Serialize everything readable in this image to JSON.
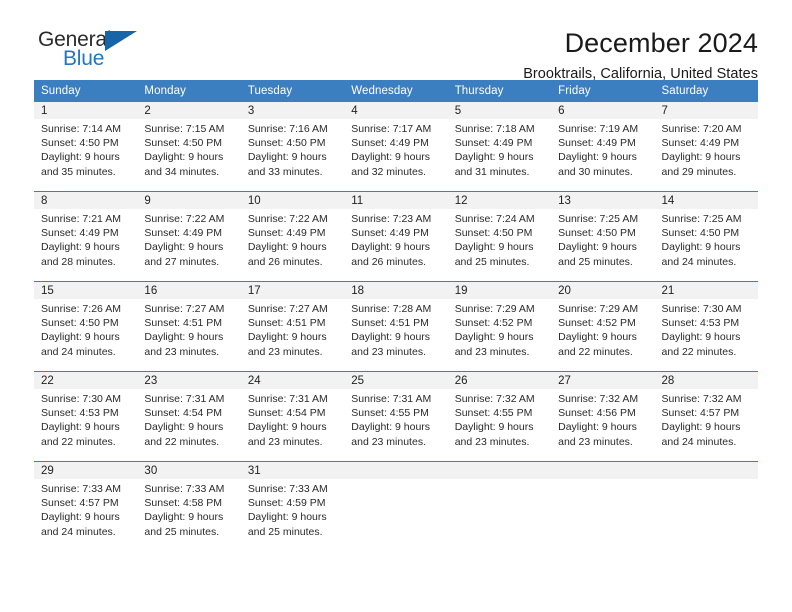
{
  "brand": {
    "name_top": "General",
    "name_bottom": "Blue",
    "accent_color": "#1f78c1",
    "triangle_color": "#1565a8"
  },
  "header": {
    "title": "December 2024",
    "subtitle": "Brooktrails, California, United States"
  },
  "calendar": {
    "header_bg": "#3c7fc1",
    "daynum_bg": "#f2f2f2",
    "weekday_headers": [
      "Sunday",
      "Monday",
      "Tuesday",
      "Wednesday",
      "Thursday",
      "Friday",
      "Saturday"
    ],
    "weeks": [
      [
        {
          "day": "1",
          "sunrise": "Sunrise: 7:14 AM",
          "sunset": "Sunset: 4:50 PM",
          "daylight_line1": "Daylight: 9 hours",
          "daylight_line2": "and 35 minutes."
        },
        {
          "day": "2",
          "sunrise": "Sunrise: 7:15 AM",
          "sunset": "Sunset: 4:50 PM",
          "daylight_line1": "Daylight: 9 hours",
          "daylight_line2": "and 34 minutes."
        },
        {
          "day": "3",
          "sunrise": "Sunrise: 7:16 AM",
          "sunset": "Sunset: 4:50 PM",
          "daylight_line1": "Daylight: 9 hours",
          "daylight_line2": "and 33 minutes."
        },
        {
          "day": "4",
          "sunrise": "Sunrise: 7:17 AM",
          "sunset": "Sunset: 4:49 PM",
          "daylight_line1": "Daylight: 9 hours",
          "daylight_line2": "and 32 minutes."
        },
        {
          "day": "5",
          "sunrise": "Sunrise: 7:18 AM",
          "sunset": "Sunset: 4:49 PM",
          "daylight_line1": "Daylight: 9 hours",
          "daylight_line2": "and 31 minutes."
        },
        {
          "day": "6",
          "sunrise": "Sunrise: 7:19 AM",
          "sunset": "Sunset: 4:49 PM",
          "daylight_line1": "Daylight: 9 hours",
          "daylight_line2": "and 30 minutes."
        },
        {
          "day": "7",
          "sunrise": "Sunrise: 7:20 AM",
          "sunset": "Sunset: 4:49 PM",
          "daylight_line1": "Daylight: 9 hours",
          "daylight_line2": "and 29 minutes."
        }
      ],
      [
        {
          "day": "8",
          "sunrise": "Sunrise: 7:21 AM",
          "sunset": "Sunset: 4:49 PM",
          "daylight_line1": "Daylight: 9 hours",
          "daylight_line2": "and 28 minutes."
        },
        {
          "day": "9",
          "sunrise": "Sunrise: 7:22 AM",
          "sunset": "Sunset: 4:49 PM",
          "daylight_line1": "Daylight: 9 hours",
          "daylight_line2": "and 27 minutes."
        },
        {
          "day": "10",
          "sunrise": "Sunrise: 7:22 AM",
          "sunset": "Sunset: 4:49 PM",
          "daylight_line1": "Daylight: 9 hours",
          "daylight_line2": "and 26 minutes."
        },
        {
          "day": "11",
          "sunrise": "Sunrise: 7:23 AM",
          "sunset": "Sunset: 4:49 PM",
          "daylight_line1": "Daylight: 9 hours",
          "daylight_line2": "and 26 minutes."
        },
        {
          "day": "12",
          "sunrise": "Sunrise: 7:24 AM",
          "sunset": "Sunset: 4:50 PM",
          "daylight_line1": "Daylight: 9 hours",
          "daylight_line2": "and 25 minutes."
        },
        {
          "day": "13",
          "sunrise": "Sunrise: 7:25 AM",
          "sunset": "Sunset: 4:50 PM",
          "daylight_line1": "Daylight: 9 hours",
          "daylight_line2": "and 25 minutes."
        },
        {
          "day": "14",
          "sunrise": "Sunrise: 7:25 AM",
          "sunset": "Sunset: 4:50 PM",
          "daylight_line1": "Daylight: 9 hours",
          "daylight_line2": "and 24 minutes."
        }
      ],
      [
        {
          "day": "15",
          "sunrise": "Sunrise: 7:26 AM",
          "sunset": "Sunset: 4:50 PM",
          "daylight_line1": "Daylight: 9 hours",
          "daylight_line2": "and 24 minutes."
        },
        {
          "day": "16",
          "sunrise": "Sunrise: 7:27 AM",
          "sunset": "Sunset: 4:51 PM",
          "daylight_line1": "Daylight: 9 hours",
          "daylight_line2": "and 23 minutes."
        },
        {
          "day": "17",
          "sunrise": "Sunrise: 7:27 AM",
          "sunset": "Sunset: 4:51 PM",
          "daylight_line1": "Daylight: 9 hours",
          "daylight_line2": "and 23 minutes."
        },
        {
          "day": "18",
          "sunrise": "Sunrise: 7:28 AM",
          "sunset": "Sunset: 4:51 PM",
          "daylight_line1": "Daylight: 9 hours",
          "daylight_line2": "and 23 minutes."
        },
        {
          "day": "19",
          "sunrise": "Sunrise: 7:29 AM",
          "sunset": "Sunset: 4:52 PM",
          "daylight_line1": "Daylight: 9 hours",
          "daylight_line2": "and 23 minutes."
        },
        {
          "day": "20",
          "sunrise": "Sunrise: 7:29 AM",
          "sunset": "Sunset: 4:52 PM",
          "daylight_line1": "Daylight: 9 hours",
          "daylight_line2": "and 22 minutes."
        },
        {
          "day": "21",
          "sunrise": "Sunrise: 7:30 AM",
          "sunset": "Sunset: 4:53 PM",
          "daylight_line1": "Daylight: 9 hours",
          "daylight_line2": "and 22 minutes."
        }
      ],
      [
        {
          "day": "22",
          "sunrise": "Sunrise: 7:30 AM",
          "sunset": "Sunset: 4:53 PM",
          "daylight_line1": "Daylight: 9 hours",
          "daylight_line2": "and 22 minutes."
        },
        {
          "day": "23",
          "sunrise": "Sunrise: 7:31 AM",
          "sunset": "Sunset: 4:54 PM",
          "daylight_line1": "Daylight: 9 hours",
          "daylight_line2": "and 22 minutes."
        },
        {
          "day": "24",
          "sunrise": "Sunrise: 7:31 AM",
          "sunset": "Sunset: 4:54 PM",
          "daylight_line1": "Daylight: 9 hours",
          "daylight_line2": "and 23 minutes."
        },
        {
          "day": "25",
          "sunrise": "Sunrise: 7:31 AM",
          "sunset": "Sunset: 4:55 PM",
          "daylight_line1": "Daylight: 9 hours",
          "daylight_line2": "and 23 minutes."
        },
        {
          "day": "26",
          "sunrise": "Sunrise: 7:32 AM",
          "sunset": "Sunset: 4:55 PM",
          "daylight_line1": "Daylight: 9 hours",
          "daylight_line2": "and 23 minutes."
        },
        {
          "day": "27",
          "sunrise": "Sunrise: 7:32 AM",
          "sunset": "Sunset: 4:56 PM",
          "daylight_line1": "Daylight: 9 hours",
          "daylight_line2": "and 23 minutes."
        },
        {
          "day": "28",
          "sunrise": "Sunrise: 7:32 AM",
          "sunset": "Sunset: 4:57 PM",
          "daylight_line1": "Daylight: 9 hours",
          "daylight_line2": "and 24 minutes."
        }
      ],
      [
        {
          "day": "29",
          "sunrise": "Sunrise: 7:33 AM",
          "sunset": "Sunset: 4:57 PM",
          "daylight_line1": "Daylight: 9 hours",
          "daylight_line2": "and 24 minutes."
        },
        {
          "day": "30",
          "sunrise": "Sunrise: 7:33 AM",
          "sunset": "Sunset: 4:58 PM",
          "daylight_line1": "Daylight: 9 hours",
          "daylight_line2": "and 25 minutes."
        },
        {
          "day": "31",
          "sunrise": "Sunrise: 7:33 AM",
          "sunset": "Sunset: 4:59 PM",
          "daylight_line1": "Daylight: 9 hours",
          "daylight_line2": "and 25 minutes."
        },
        {
          "day": "",
          "sunrise": "",
          "sunset": "",
          "daylight_line1": "",
          "daylight_line2": ""
        },
        {
          "day": "",
          "sunrise": "",
          "sunset": "",
          "daylight_line1": "",
          "daylight_line2": ""
        },
        {
          "day": "",
          "sunrise": "",
          "sunset": "",
          "daylight_line1": "",
          "daylight_line2": ""
        },
        {
          "day": "",
          "sunrise": "",
          "sunset": "",
          "daylight_line1": "",
          "daylight_line2": ""
        }
      ]
    ]
  }
}
